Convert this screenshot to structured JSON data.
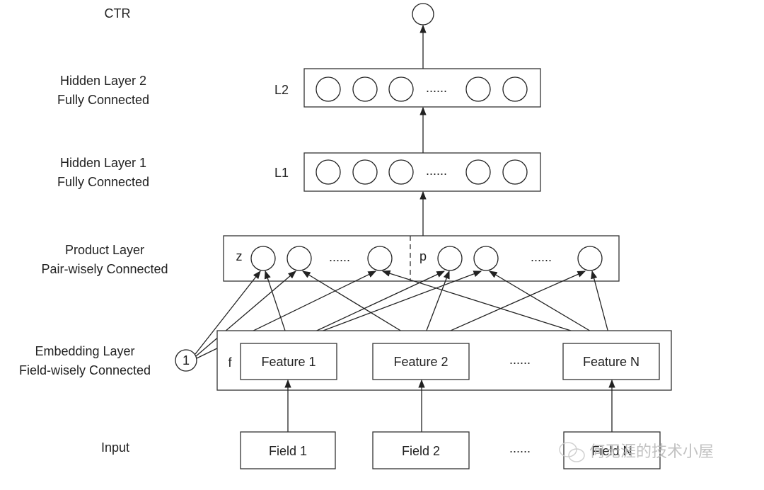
{
  "layers": {
    "ctr": "CTR",
    "hidden2": [
      "Hidden Layer 2",
      "Fully Connected"
    ],
    "hidden1": [
      "Hidden Layer 1",
      "Fully Connected"
    ],
    "product": [
      "Product Layer",
      "Pair-wisely Connected"
    ],
    "embedding": [
      "Embedding Layer",
      "Field-wisely Connected"
    ],
    "input": "Input"
  },
  "tags": {
    "l2": "L2",
    "l1": "L1",
    "z": "z",
    "p": "p",
    "f": "f",
    "one": "1"
  },
  "ellipsis": "......",
  "features": [
    "Feature 1",
    "Feature 2",
    "Feature N"
  ],
  "fields": [
    "Field 1",
    "Field 2",
    "Field N"
  ],
  "watermark": "何无涯的技术小屋"
}
